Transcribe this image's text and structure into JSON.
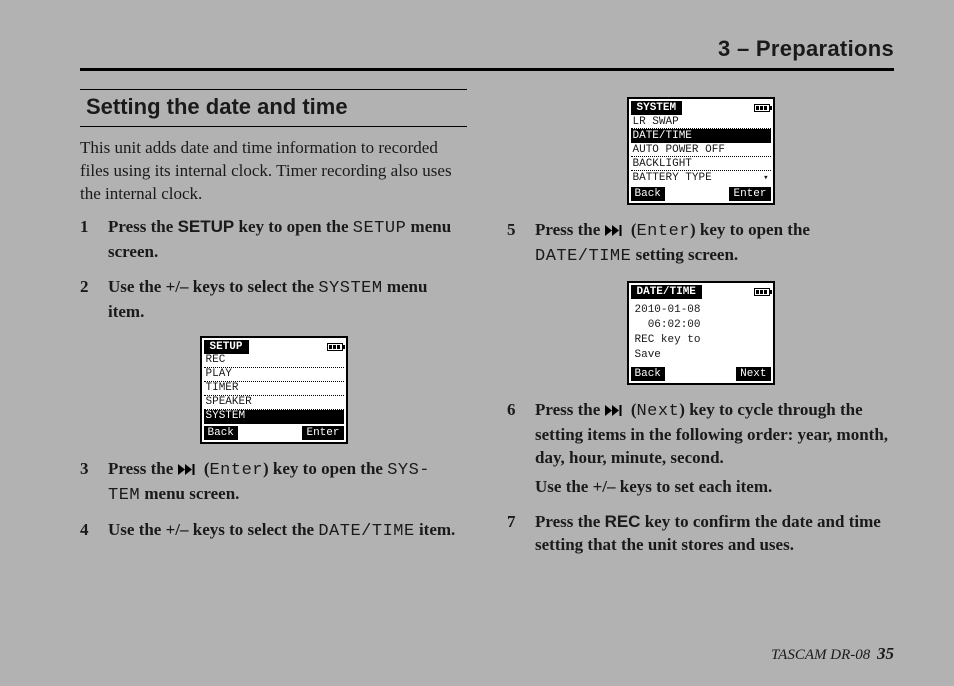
{
  "chapter": "3 – Preparations",
  "section_title": "Setting the date and time",
  "intro": "This unit adds date and time information to recorded files using its internal clock. Timer recording also uses the internal clock.",
  "footer": {
    "product": "TASCAM  DR-08",
    "page": "35"
  },
  "keys": {
    "setup_key": "SETUP",
    "rec_key": "REC",
    "plus_minus": "+/–"
  },
  "mono": {
    "setup": "SETUP",
    "system": "SYSTEM",
    "sys_tem_a": "SYS-",
    "sys_tem_b": "TEM",
    "enter": "Enter",
    "next": "Next",
    "date_time": "DATE/TIME"
  },
  "steps_left": {
    "s1": {
      "num": "1",
      "a": "Press the ",
      "b": " key to open the ",
      "c": " menu screen."
    },
    "s2": {
      "num": "2",
      "a": "Use the ",
      "b": " keys to select the ",
      "c": " menu item."
    },
    "s3": {
      "num": "3",
      "a": "Press the ",
      "b": " (",
      "c": ") key to open the ",
      "d": " menu screen."
    },
    "s4": {
      "num": "4",
      "a": "Use the ",
      "b": " keys to select the ",
      "c": " item."
    }
  },
  "steps_right": {
    "s5": {
      "num": "5",
      "a": "Press the ",
      "b": " (",
      "c": ") key to open the ",
      "d": " setting screen."
    },
    "s6": {
      "num": "6",
      "a": "Press the ",
      "b": " (",
      "c": ") key to cycle through the setting items in the following order: year, month, day, hour, minute, second.",
      "sub_a": "Use the ",
      "sub_b": " keys to set each item."
    },
    "s7": {
      "num": "7",
      "a": "Press the ",
      "b": " key to confirm the date and time setting that the unit stores and uses."
    }
  },
  "lcd1": {
    "title": "SETUP",
    "rows": [
      "REC",
      "PLAY",
      "TIMER",
      "SPEAKER",
      "SYSTEM"
    ],
    "selected": 4,
    "footer_left": "Back",
    "footer_right": "Enter"
  },
  "lcd2": {
    "title": "SYSTEM",
    "rows": [
      "LR SWAP",
      "DATE/TIME",
      "AUTO POWER OFF",
      "BACKLIGHT",
      "BATTERY TYPE"
    ],
    "selected": 1,
    "has_scroll": true,
    "footer_left": "Back",
    "footer_right": "Enter"
  },
  "lcd3": {
    "title": "DATE/TIME",
    "lines": [
      "2010‑01‑08",
      "  06:02:00",
      "",
      "REC key to",
      "Save"
    ],
    "footer_left": "Back",
    "footer_right": "Next"
  }
}
